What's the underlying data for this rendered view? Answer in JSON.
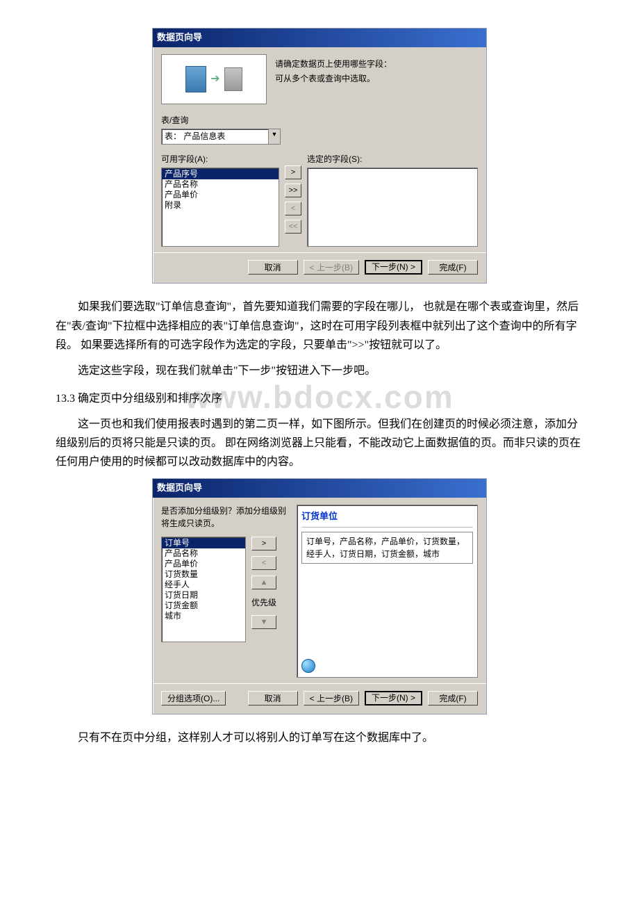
{
  "watermark": "www.bdocx.com",
  "dialog1": {
    "title": "数据页向导",
    "prompt_line1": "请确定数据页上使用哪些字段：",
    "prompt_line2": "可从多个表或查询中选取。",
    "tq_label": "表/查询",
    "tq_value": "表： 产品信息表",
    "avail_label": "可用字段(A):",
    "sel_label": "选定的字段(S):",
    "avail_items": [
      "产品序号",
      "产品名称",
      "产品单价",
      "附录"
    ],
    "btn_gt": ">",
    "btn_gtgt": ">>",
    "btn_lt": "<",
    "btn_ltlt": "<<",
    "btn_cancel": "取消",
    "btn_back": "< 上一步(B)",
    "btn_next": "下一步(N) >",
    "btn_finish": "完成(F)"
  },
  "para1": "如果我们要选取\"订单信息查询\"，首先要知道我们需要的字段在哪儿， 也就是在哪个表或查询里，然后在\"表/查询\"下拉框中选择相应的表\"订单信息查询\"，这时在可用字段列表框中就列出了这个查询中的所有字段。 如果要选择所有的可选字段作为选定的字段，只要单击\">>\"按钮就可以了。",
  "para2": "选定这些字段，现在我们就单击\"下一步\"按钮进入下一步吧。",
  "heading": "13.3 确定页中分组级别和排序次序",
  "para3": "这一页也和我们使用报表时遇到的第二页一样，如下图所示。但我们在创建页的时候必须注意，添加分组级别后的页将只能是只读的页。 即在网络浏览器上只能看，不能改动它上面数据值的页。而非只读的页在任何用户使用的时候都可以改动数据库中的内容。",
  "dialog2": {
    "title": "数据页向导",
    "intro": "是否添加分组级别？添加分组级别将生成只读页。",
    "left_items": [
      "订单号",
      "产品名称",
      "产品单价",
      "订货数量",
      "经手人",
      "订货日期",
      "订货金额",
      "城市"
    ],
    "btn_gt": ">",
    "btn_lt": "<",
    "btn_up": "▲",
    "btn_down": "▼",
    "priority_label": "优先级",
    "preview_header": "订货单位",
    "preview_fields": "订单号，产品名称，产品单价，订货数量，经手人，订货日期，订货金额，城市",
    "btn_group_opts": "分组选项(O)...",
    "btn_cancel": "取消",
    "btn_back": "< 上一步(B)",
    "btn_next": "下一步(N) >",
    "btn_finish": "完成(F)"
  },
  "para4": "只有不在页中分组，这样别人才可以将别人的订单写在这个数据库中了。"
}
